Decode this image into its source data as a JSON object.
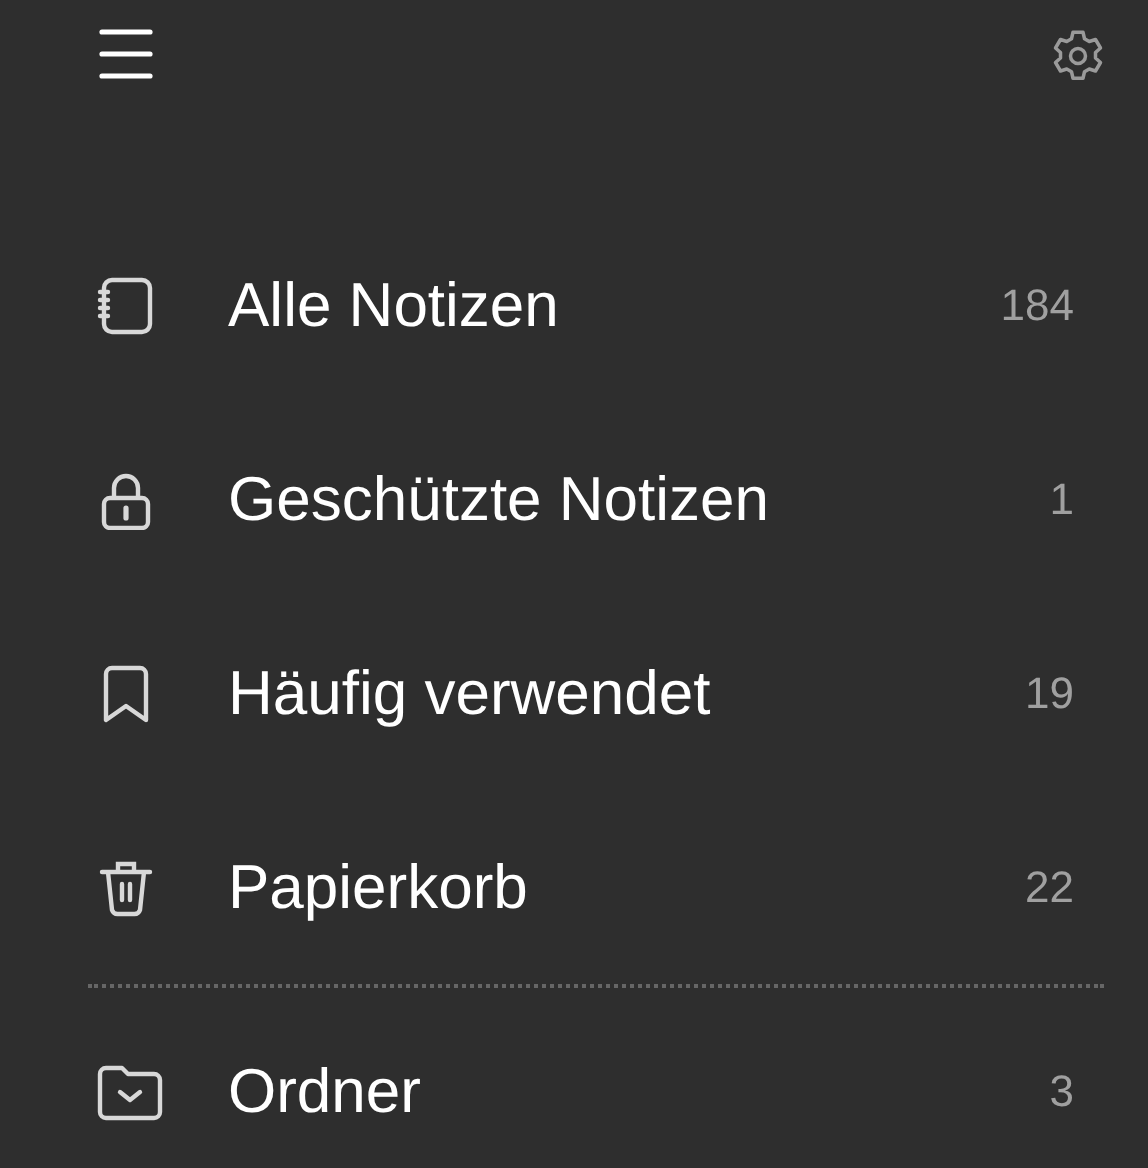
{
  "items": [
    {
      "kind": "notebook",
      "label": "Alle Notizen",
      "count": "184"
    },
    {
      "kind": "lock",
      "label": "Geschützte Notizen",
      "count": "1"
    },
    {
      "kind": "bookmark",
      "label": "Häufig verwendet",
      "count": "19"
    },
    {
      "kind": "trash",
      "label": "Papierkorb",
      "count": "22"
    }
  ],
  "folders": {
    "kind": "folder",
    "label": "Ordner",
    "count": "3"
  }
}
